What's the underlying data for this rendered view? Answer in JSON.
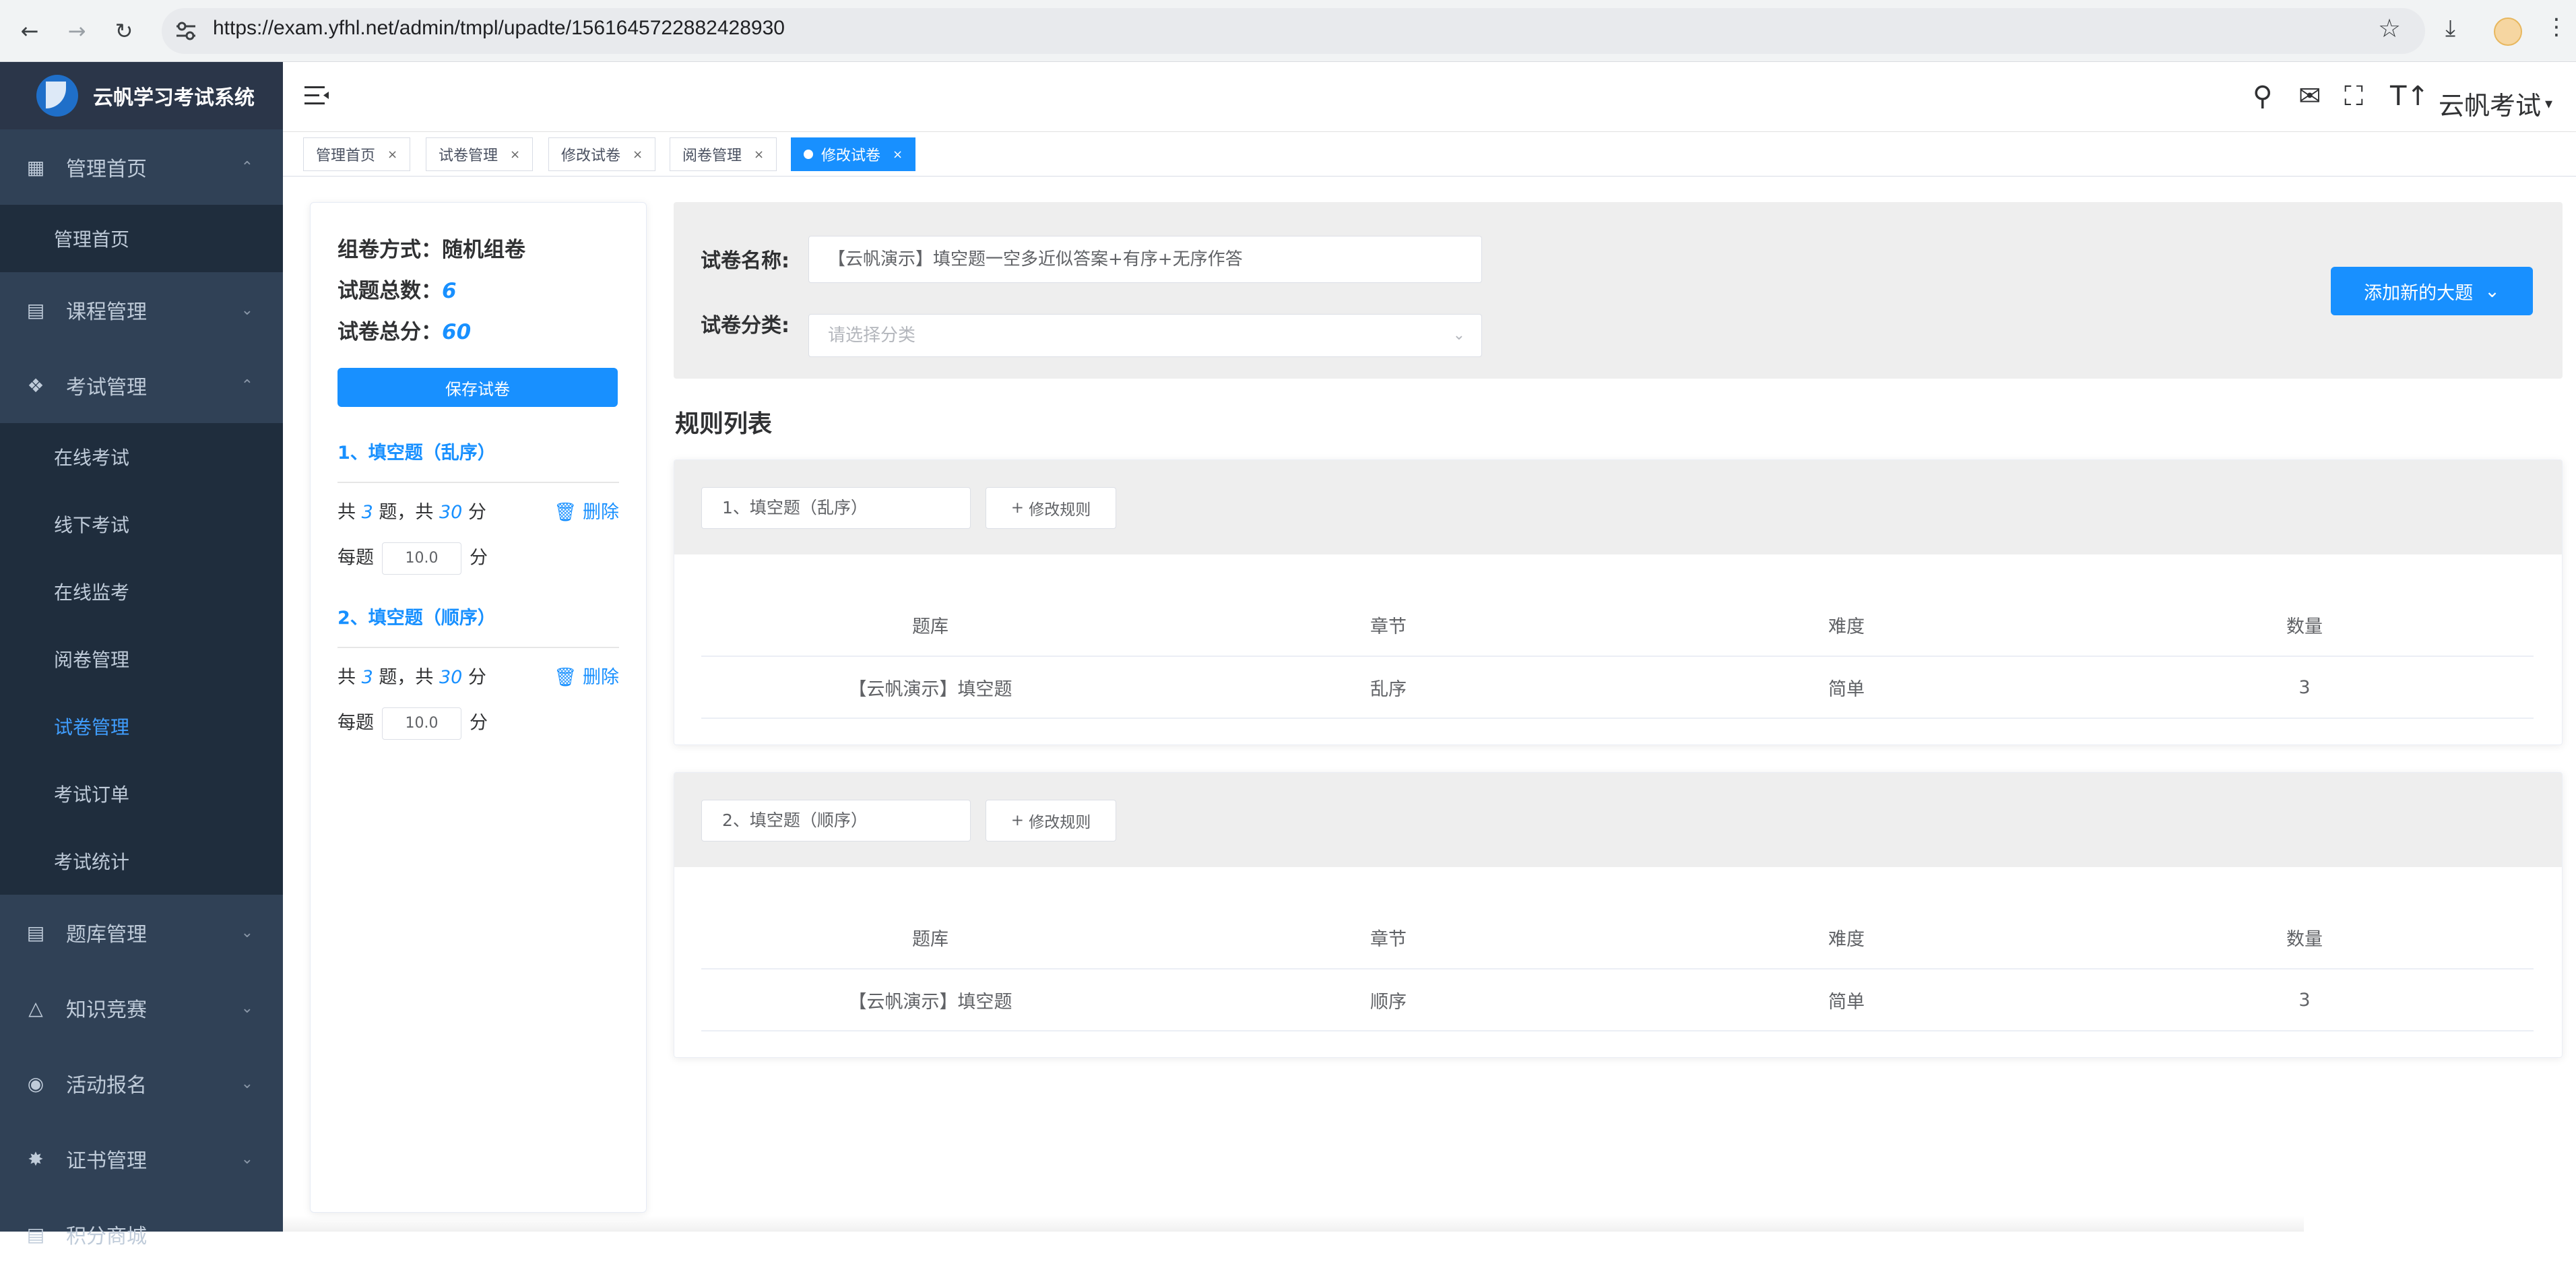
{
  "browser": {
    "url": "https://exam.yfhl.net/admin/tmpl/upadte/1561645722882428930"
  },
  "sidebar": {
    "app_name": "云帆学习考试系统",
    "menus": [
      {
        "label": "管理首页",
        "icon": "dashboard-icon",
        "expanded": true
      },
      {
        "label": "课程管理",
        "icon": "monitor-icon",
        "expanded": false
      },
      {
        "label": "考试管理",
        "icon": "exam-icon",
        "expanded": true
      },
      {
        "label": "题库管理",
        "icon": "document-icon",
        "expanded": false
      },
      {
        "label": "知识竞赛",
        "icon": "fire-icon",
        "expanded": false
      },
      {
        "label": "活动报名",
        "icon": "target-icon",
        "expanded": false
      },
      {
        "label": "证书管理",
        "icon": "badge-icon",
        "expanded": false
      },
      {
        "label": "积分商城",
        "icon": "cart-icon",
        "expanded": false
      }
    ],
    "home_sub": [
      "管理首页"
    ],
    "exam_sub": [
      "在线考试",
      "线下考试",
      "在线监考",
      "阅卷管理",
      "试卷管理",
      "考试订单",
      "考试统计"
    ],
    "active_item": "试卷管理"
  },
  "topbar": {
    "user_name": "云帆考试"
  },
  "tags": [
    {
      "label": "管理首页",
      "active": false
    },
    {
      "label": "试卷管理",
      "active": false
    },
    {
      "label": "修改试卷",
      "active": false
    },
    {
      "label": "阅卷管理",
      "active": false
    },
    {
      "label": "修改试卷",
      "active": true
    }
  ],
  "summary": {
    "mode_label": "组卷方式：",
    "mode_value": "随机组卷",
    "count_label": "试题总数：",
    "count_value": "6",
    "score_label": "试卷总分：",
    "score_value": "60",
    "save_label": "保存试卷",
    "delete_label": "删除",
    "per_label": "每题",
    "unit_label": "分",
    "groups": [
      {
        "title": "1、填空题（乱序）",
        "count": "3",
        "score": "30",
        "per_score": "10.0"
      },
      {
        "title": "2、填空题（顺序）",
        "count": "3",
        "score": "30",
        "per_score": "10.0"
      }
    ]
  },
  "form": {
    "name_label": "试卷名称:",
    "name_value": "【云帆演示】填空题一空多近似答案+有序+无序作答",
    "category_label": "试卷分类:",
    "category_placeholder": "请选择分类",
    "add_button": "添加新的大题"
  },
  "rules": {
    "title": "规则列表",
    "edit_label": "修改规则",
    "columns": [
      "题库",
      "章节",
      "难度",
      "数量"
    ],
    "items": [
      {
        "name": "1、填空题（乱序）",
        "row": [
          "【云帆演示】填空题",
          "乱序",
          "简单",
          "3"
        ]
      },
      {
        "name": "2、填空题（顺序）",
        "row": [
          "【云帆演示】填空题",
          "顺序",
          "简单",
          "3"
        ]
      }
    ]
  },
  "colors": {
    "primary": "#1890ff",
    "sidebar": "#304156",
    "sidebar_sub": "#1f2d3d"
  }
}
